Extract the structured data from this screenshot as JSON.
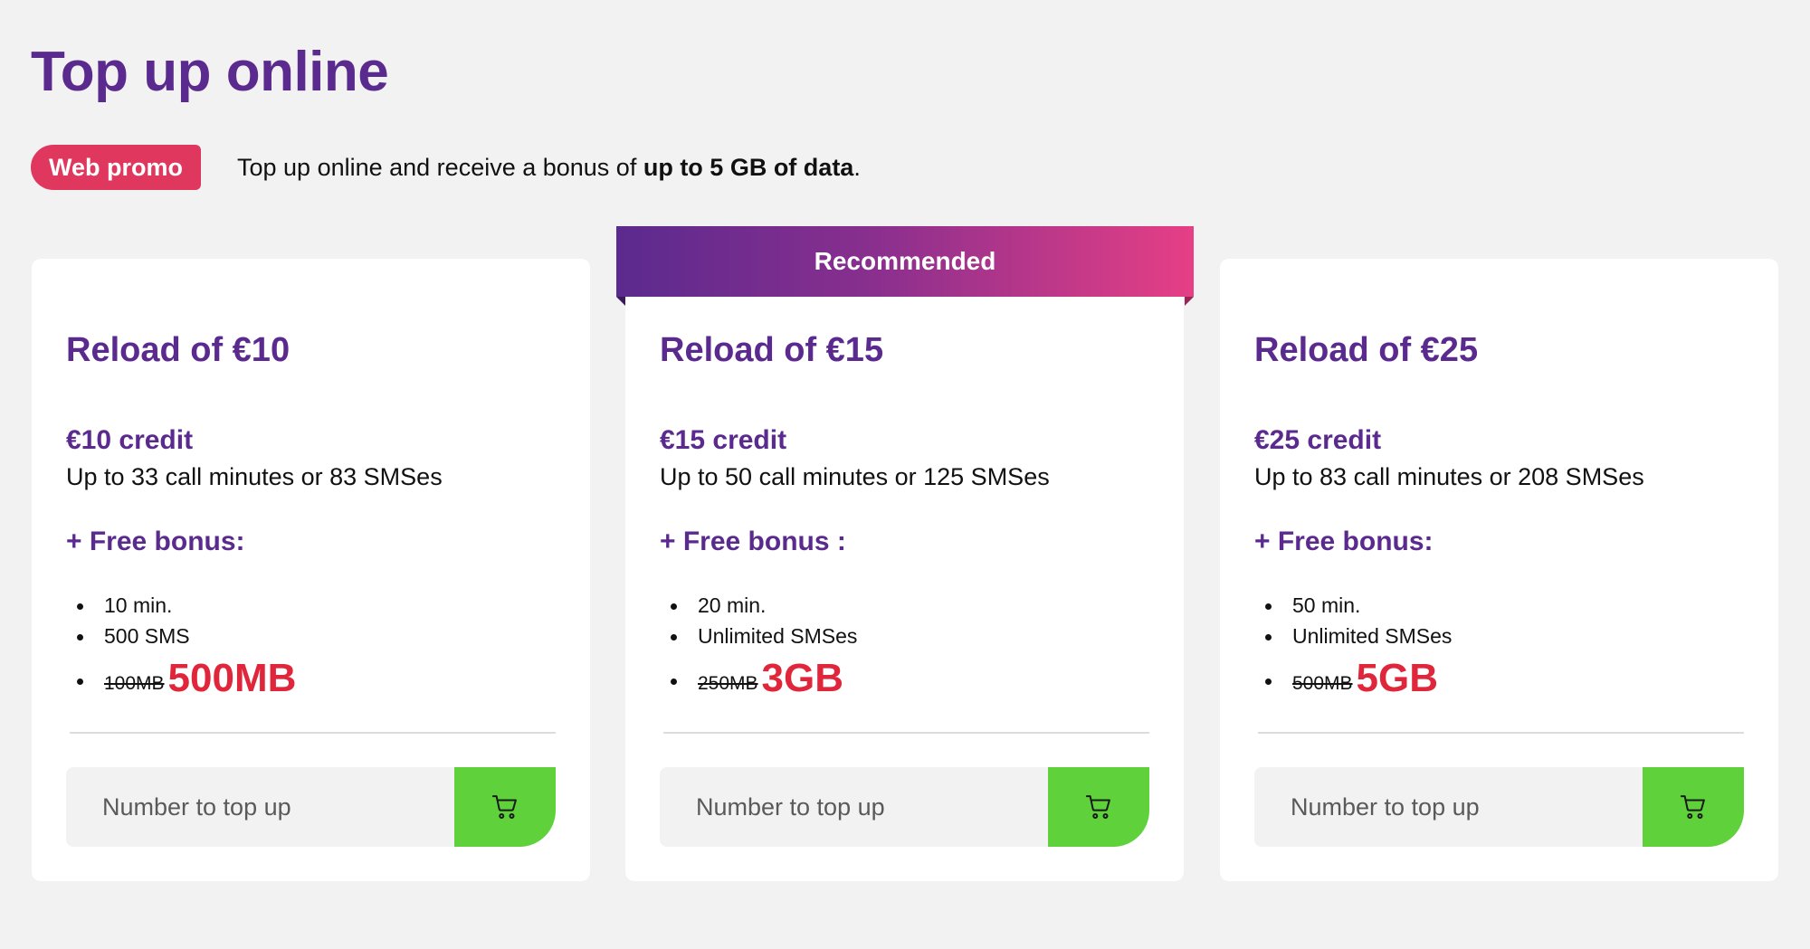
{
  "page": {
    "title": "Top up online"
  },
  "promo": {
    "badge": "Web promo",
    "text_prefix": "Top up online and receive a bonus of ",
    "text_bold": "up to 5 GB of data",
    "text_suffix": "."
  },
  "recommended_label": "Recommended",
  "cards": [
    {
      "title": "Reload of €10",
      "credit": "€10 credit",
      "description": "Up to 33 call minutes or 83 SMSes",
      "bonus_title": "+ Free bonus:",
      "bonus_items": [
        "10 min.",
        "500 SMS"
      ],
      "old_data": "100MB",
      "new_data": "500MB",
      "input_placeholder": "Number to top up",
      "cart_icon": "cart-icon"
    },
    {
      "title": "Reload of €15",
      "credit": "€15 credit",
      "description": "Up to 50 call minutes or 125 SMSes",
      "bonus_title": "+ Free bonus :",
      "bonus_items": [
        "20 min.",
        "Unlimited SMSes"
      ],
      "old_data": "250MB",
      "new_data": "3GB",
      "input_placeholder": "Number to top up",
      "cart_icon": "cart-icon"
    },
    {
      "title": "Reload of €25",
      "credit": "€25 credit",
      "description": "Up to 83 call minutes or 208 SMSes",
      "bonus_title": "+ Free bonus:",
      "bonus_items": [
        "50 min.",
        "Unlimited SMSes"
      ],
      "old_data": "500MB",
      "new_data": "5GB",
      "input_placeholder": "Number to top up",
      "cart_icon": "cart-icon"
    }
  ],
  "colors": {
    "brand_purple": "#5b2a8e",
    "promo_red": "#e0375e",
    "data_red": "#e0263b",
    "cart_green": "#5fd13b",
    "ribbon_start": "#5b2a8e",
    "ribbon_end": "#e63f85"
  }
}
